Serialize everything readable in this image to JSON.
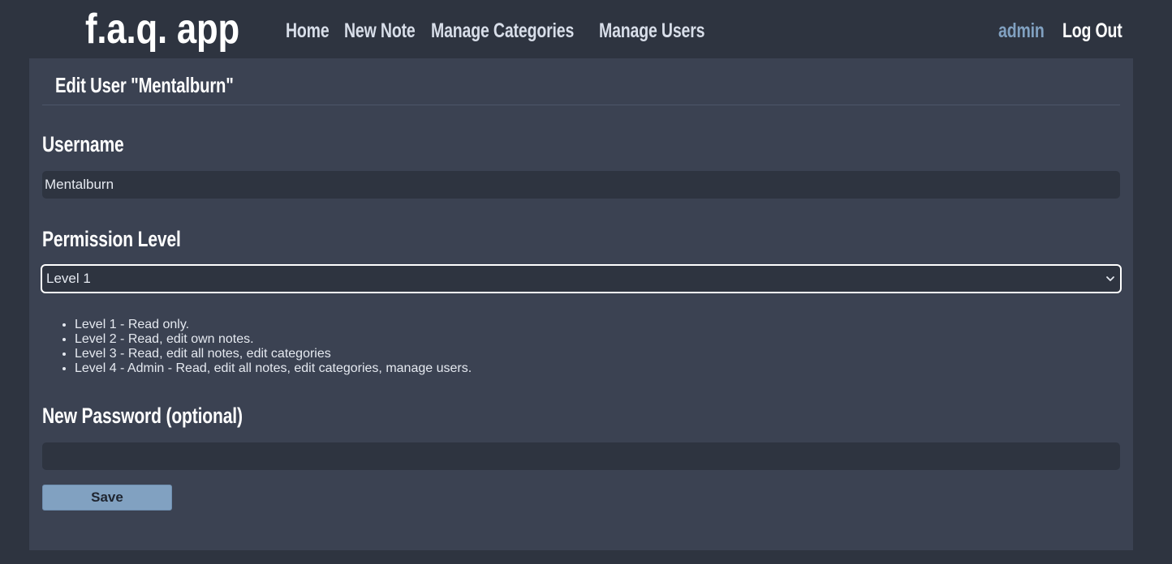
{
  "app": {
    "logo": "f.a.q. app"
  },
  "nav": {
    "items": [
      {
        "label": "Home"
      },
      {
        "label": "New Note"
      },
      {
        "label": "Manage Categories"
      },
      {
        "label": "Manage Users"
      }
    ],
    "current_user": "admin",
    "logout_label": "Log Out"
  },
  "page": {
    "title": "Edit User \"Mentalburn\""
  },
  "form": {
    "username_label": "Username",
    "username_value": "Mentalburn",
    "permission_label": "Permission Level",
    "permission_selected": "Level 1",
    "permission_levels": [
      "Level 1 - Read only.",
      "Level 2 - Read, edit own notes.",
      "Level 3 - Read, edit all notes, edit categories",
      "Level 4 - Admin - Read, edit all notes, edit categories, manage users."
    ],
    "password_label": "New Password (optional)",
    "password_value": "",
    "save_label": "Save"
  },
  "icons": {
    "select_chevron": "chevron-down-icon"
  },
  "colors": {
    "background": "#2e3440",
    "panel": "#3b4252",
    "input": "#2e3440",
    "nav_text": "#d8dee9",
    "current_user": "#81a1c1",
    "save_button": "#81a1c1"
  }
}
